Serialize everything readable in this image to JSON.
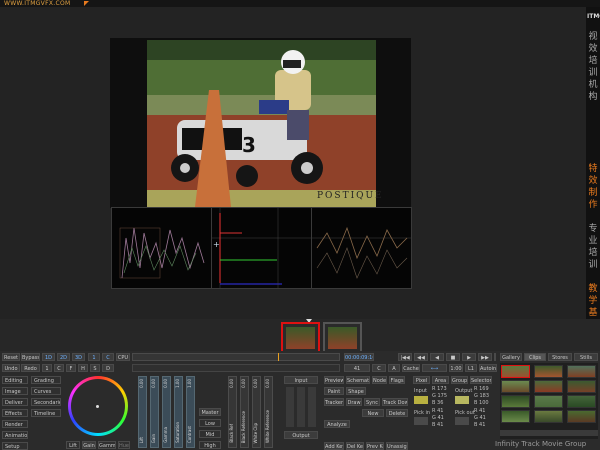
{
  "app": {
    "url_text": "WWW.ITMGVFX.COM",
    "watermark": "Infinity Track Movie Group",
    "brand_vertical": [
      "ITMG",
      "视",
      "效",
      "培",
      "训",
      "机",
      "构",
      "特",
      "效",
      "制",
      "作",
      "专",
      "业",
      "培",
      "训",
      "教",
      "学",
      "基",
      "地"
    ],
    "accent_color": "#e87a1e"
  },
  "viewer": {
    "overlay_text": "POSTIQUE",
    "scopes": [
      "waveform",
      "vectorscope",
      "histogram"
    ]
  },
  "timeline": {
    "thumbnails": [
      {
        "name": "clip-1",
        "selected": true
      },
      {
        "name": "clip-2",
        "selected": false
      }
    ]
  },
  "panel": {
    "row1": [
      "Reset",
      "Bypass",
      "1D",
      "2D",
      "3D",
      "1",
      "C",
      "CPU"
    ],
    "row2": [
      "Undo",
      "Redo",
      "1",
      "C",
      "F",
      "H",
      "S",
      "D"
    ],
    "left_menu": [
      "Editing",
      "Image",
      "Deliver",
      "Effects",
      "Render",
      "Animation",
      "Setup"
    ],
    "left_menu2": [
      "Grading",
      "Curves",
      "Secondaries",
      "Timeline"
    ],
    "wheel_buttons": [
      "Lift",
      "Gain",
      "Gamma",
      "Hue"
    ],
    "sliders": [
      {
        "label": "Lift",
        "value": "0.00"
      },
      {
        "label": "Gain",
        "value": "0.00"
      },
      {
        "label": "Gamma",
        "value": "0.00"
      },
      {
        "label": "Saturation",
        "value": "1.00"
      },
      {
        "label": "Contrast",
        "value": "1.00"
      }
    ],
    "master_buttons": [
      "Master",
      "Low",
      "Mid",
      "High"
    ],
    "ref_sliders": [
      {
        "label": "Black Ref",
        "value": "0.00"
      },
      {
        "label": "Black Reference",
        "value": "0.00"
      },
      {
        "label": "White Clip",
        "value": "0.00"
      },
      {
        "label": "White Reference",
        "value": "0.00"
      }
    ],
    "mid_buttons": {
      "input": "Input",
      "output": "Output",
      "tools": [
        "Preview",
        "Schematic",
        "Nodes",
        "Flags"
      ],
      "tools2": [
        "Paint",
        "Shape"
      ],
      "tools3": [
        "Tracker",
        "Draw",
        "Sync",
        "Track Down"
      ],
      "new_delete": [
        "New",
        "Delete"
      ],
      "analyze": "Analyze",
      "bottom": [
        "Add Key",
        "Del Key",
        "Prev Key",
        "Unassign"
      ]
    },
    "transport": {
      "timecode": "00:00:09:16",
      "fields": [
        "41",
        "C",
        "A",
        "Cache",
        "1:00",
        "L1",
        "Autoin"
      ],
      "buttons": [
        "|◀◀",
        "◀◀",
        "◀",
        "■",
        "▶",
        "▶▶",
        "▶▶|"
      ]
    },
    "color_tabs": [
      "Pixel",
      "Area",
      "Group",
      "Selector"
    ],
    "input_values": {
      "R": "173",
      "G": "175",
      "B": "36"
    },
    "output_values": {
      "R": "169",
      "G": "183",
      "B": "100"
    },
    "pick_in": {
      "R": "41",
      "G": "41",
      "B": "41"
    },
    "pick_out": {
      "R": "41",
      "G": "41",
      "B": "41"
    },
    "bin_tabs": [
      "Gallery",
      "Clips",
      "Stores",
      "Stills"
    ]
  }
}
